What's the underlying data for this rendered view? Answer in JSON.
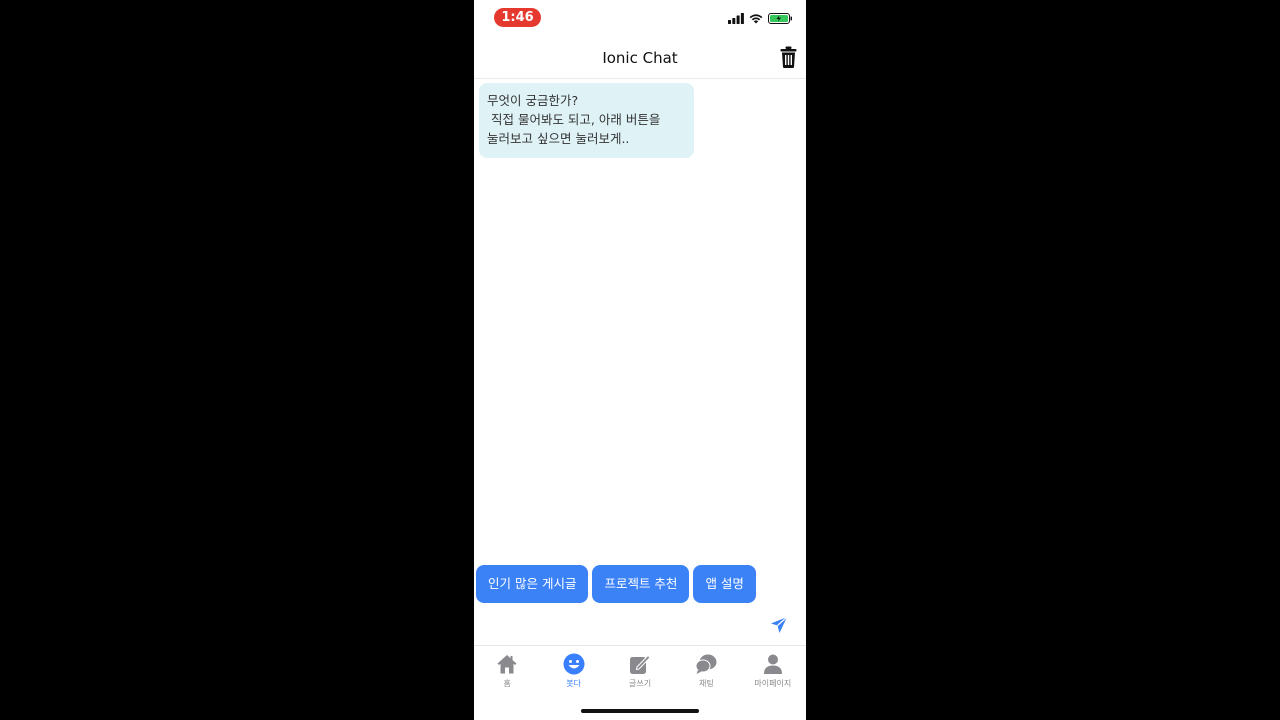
{
  "status_bar": {
    "time": "1:46",
    "icons": [
      "signal-icon",
      "wifi-icon",
      "battery-icon"
    ]
  },
  "header": {
    "title": "Ionic Chat",
    "action_icon": "trash-icon"
  },
  "chat": {
    "messages": [
      {
        "sender": "bot",
        "lines": [
          "무엇이 궁금한가?",
          " 직접 물어봐도 되고, 아래 버튼을",
          "눌러보고 싶으면 눌러보게.."
        ]
      }
    ]
  },
  "quick_replies": [
    "인기 많은 게시글",
    "프로젝트 추천",
    "앱 설명"
  ],
  "send_icon": "send-icon",
  "tabs": [
    {
      "label": "홈",
      "icon": "home-icon",
      "active": false
    },
    {
      "label": "봇다",
      "icon": "happy-face-icon",
      "active": true
    },
    {
      "label": "글쓰기",
      "icon": "compose-icon",
      "active": false
    },
    {
      "label": "채팅",
      "icon": "chat-bubbles-icon",
      "active": false
    },
    {
      "label": "마이페이지",
      "icon": "person-icon",
      "active": false
    }
  ],
  "colors": {
    "time_pill": "#e5392f",
    "bot_bubble": "#dff3f7",
    "quick_button": "#3b82f6",
    "active_tab": "#3880ff",
    "inactive_tab": "#8a8a8e"
  }
}
